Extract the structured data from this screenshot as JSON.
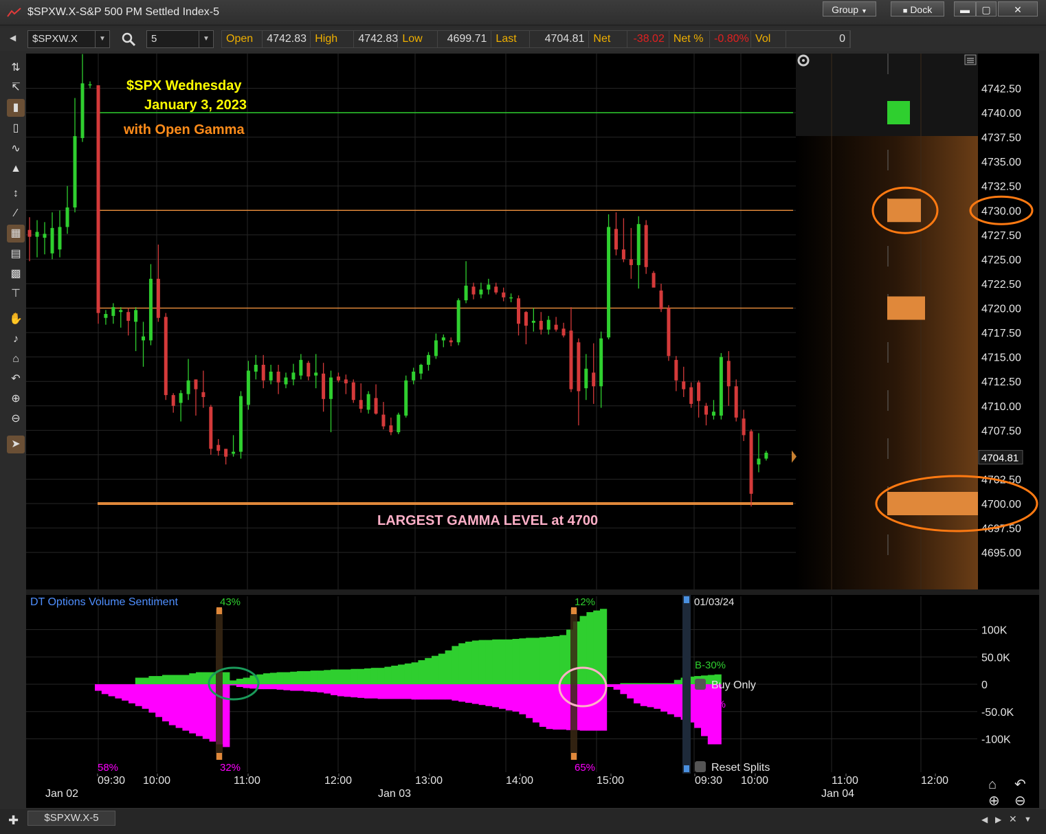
{
  "window": {
    "title": "$SPXW.X-S&P 500 PM Settled Index-5",
    "group_label": "Group",
    "dock_label": "Dock"
  },
  "toolbar": {
    "symbol": "$SPXW.X",
    "interval": "5",
    "quote": [
      {
        "label": "Open",
        "value": "4742.83",
        "style": "normal"
      },
      {
        "label": "High",
        "value": "4742.83",
        "style": "normal"
      },
      {
        "label": "Low",
        "value": "4699.71",
        "style": "normal"
      },
      {
        "label": "Last",
        "value": "4704.81",
        "style": "normal"
      },
      {
        "label": "Net",
        "value": "-38.02",
        "style": "neg"
      },
      {
        "label": "Net %",
        "value": "-0.80%",
        "style": "neg"
      },
      {
        "label": "Vol",
        "value": "0",
        "style": "normal"
      }
    ]
  },
  "annotations": {
    "line1": "$SPX Wednesday",
    "line2": "January  3, 2023",
    "line3": "with Open Gamma",
    "gamma_label": "LARGEST GAMMA LEVEL at 4700"
  },
  "colors": {
    "up": "#2fcf2f",
    "down": "#d43a3a",
    "gamma": "#e0883a",
    "accent_text": "#ffff00",
    "orange_text": "#ff8c1a",
    "pink_text": "#ffb0c8",
    "magenta": "#ff00ff"
  },
  "chart_data": [
    {
      "type": "candlestick",
      "title": "$SPXW.X-S&P 500 PM Settled Index-5",
      "price_axis_ticks": [
        "4742.50",
        "4740.00",
        "4737.50",
        "4735.00",
        "4732.50",
        "4730.00",
        "4727.50",
        "4725.00",
        "4722.50",
        "4720.00",
        "4717.50",
        "4715.00",
        "4712.50",
        "4710.00",
        "4707.50",
        "4705.00",
        "4702.50",
        "4700.00",
        "4697.50",
        "4695.00"
      ],
      "last_price_label": "4704.81",
      "ylim": [
        4693,
        4745
      ],
      "x_tick_labels": [
        "09:30",
        "10:00",
        "11:00",
        "12:00",
        "13:00",
        "14:00",
        "15:00",
        "09:30",
        "10:00",
        "11:00",
        "12:00"
      ],
      "date_labels": [
        "Jan 02",
        "Jan 03",
        "Jan 04"
      ],
      "horizontal_levels": [
        {
          "price": 4740.0,
          "color": "#2fcf2f"
        },
        {
          "price": 4730.0,
          "color": "#e0883a"
        },
        {
          "price": 4720.0,
          "color": "#e0883a"
        },
        {
          "price": 4700.0,
          "color": "#e0883a"
        }
      ],
      "prev_session_candles": [
        {
          "o": 4728.0,
          "h": 4729.3,
          "l": 4724.8,
          "c": 4727.3
        },
        {
          "o": 4727.3,
          "h": 4729.0,
          "l": 4725.2,
          "c": 4727.8
        },
        {
          "o": 4727.2,
          "h": 4728.8,
          "l": 4725.5,
          "c": 4727.6
        },
        {
          "o": 4725.6,
          "h": 4729.8,
          "l": 4725.0,
          "c": 4728.2
        },
        {
          "o": 4726.0,
          "h": 4730.0,
          "l": 4725.2,
          "c": 4728.3
        },
        {
          "o": 4728.3,
          "h": 4732.5,
          "l": 4727.6,
          "c": 4730.3
        },
        {
          "o": 4730.3,
          "h": 4741.5,
          "l": 4729.8,
          "c": 4737.6
        },
        {
          "o": 4737.4,
          "h": 4746.0,
          "l": 4737.0,
          "c": 4743.0
        },
        {
          "o": 4742.8,
          "h": 4743.2,
          "l": 4742.5,
          "c": 4742.9
        }
      ],
      "session_candles": [
        {
          "o": 4742.8,
          "h": 4742.8,
          "l": 4718.4,
          "c": 4719.5
        },
        {
          "o": 4719.0,
          "h": 4719.8,
          "l": 4718.3,
          "c": 4719.4
        },
        {
          "o": 4719.2,
          "h": 4720.5,
          "l": 4718.4,
          "c": 4720.1
        },
        {
          "o": 4719.6,
          "h": 4720.1,
          "l": 4718.0,
          "c": 4719.8
        },
        {
          "o": 4719.6,
          "h": 4720.0,
          "l": 4717.2,
          "c": 4718.7
        },
        {
          "o": 4718.6,
          "h": 4720.1,
          "l": 4715.6,
          "c": 4719.8
        },
        {
          "o": 4716.7,
          "h": 4718.6,
          "l": 4714.0,
          "c": 4717.1
        },
        {
          "o": 4716.7,
          "h": 4724.5,
          "l": 4716.2,
          "c": 4723.0
        },
        {
          "o": 4723.0,
          "h": 4726.5,
          "l": 4718.6,
          "c": 4719.0
        },
        {
          "o": 4719.1,
          "h": 4719.5,
          "l": 4710.6,
          "c": 4711.1
        },
        {
          "o": 4711.1,
          "h": 4711.3,
          "l": 4709.3,
          "c": 4710.0
        },
        {
          "o": 4710.3,
          "h": 4711.6,
          "l": 4708.4,
          "c": 4711.3
        },
        {
          "o": 4711.2,
          "h": 4714.8,
          "l": 4710.6,
          "c": 4712.6
        },
        {
          "o": 4712.7,
          "h": 4712.7,
          "l": 4709.0,
          "c": 4711.7
        },
        {
          "o": 4711.4,
          "h": 4713.6,
          "l": 4709.8,
          "c": 4710.9
        },
        {
          "o": 4709.9,
          "h": 4710.1,
          "l": 4705.0,
          "c": 4705.6
        },
        {
          "o": 4706.0,
          "h": 4706.6,
          "l": 4704.9,
          "c": 4705.4
        },
        {
          "o": 4705.6,
          "h": 4705.6,
          "l": 4704.0,
          "c": 4704.8
        },
        {
          "o": 4705.1,
          "h": 4707.0,
          "l": 4704.8,
          "c": 4705.3
        },
        {
          "o": 4705.3,
          "h": 4711.5,
          "l": 4704.6,
          "c": 4711.0
        },
        {
          "o": 4710.1,
          "h": 4714.6,
          "l": 4709.6,
          "c": 4713.6
        },
        {
          "o": 4713.5,
          "h": 4715.2,
          "l": 4712.7,
          "c": 4714.2
        },
        {
          "o": 4714.2,
          "h": 4715.2,
          "l": 4711.8,
          "c": 4712.6
        },
        {
          "o": 4712.6,
          "h": 4714.2,
          "l": 4712.2,
          "c": 4713.5
        },
        {
          "o": 4713.5,
          "h": 4714.2,
          "l": 4711.2,
          "c": 4712.4
        },
        {
          "o": 4712.2,
          "h": 4713.4,
          "l": 4711.8,
          "c": 4712.9
        },
        {
          "o": 4712.7,
          "h": 4714.3,
          "l": 4712.1,
          "c": 4713.4
        },
        {
          "o": 4713.1,
          "h": 4715.3,
          "l": 4712.7,
          "c": 4714.7
        },
        {
          "o": 4714.4,
          "h": 4714.6,
          "l": 4712.6,
          "c": 4713.0
        },
        {
          "o": 4713.1,
          "h": 4715.3,
          "l": 4711.8,
          "c": 4713.4
        },
        {
          "o": 4713.3,
          "h": 4714.4,
          "l": 4709.4,
          "c": 4710.7
        },
        {
          "o": 4710.7,
          "h": 4713.6,
          "l": 4707.3,
          "c": 4712.9
        },
        {
          "o": 4713.0,
          "h": 4713.4,
          "l": 4712.4,
          "c": 4712.6
        },
        {
          "o": 4712.7,
          "h": 4713.2,
          "l": 4711.2,
          "c": 4712.3
        },
        {
          "o": 4712.4,
          "h": 4712.7,
          "l": 4710.3,
          "c": 4710.6
        },
        {
          "o": 4710.6,
          "h": 4712.3,
          "l": 4709.3,
          "c": 4709.7
        },
        {
          "o": 4709.6,
          "h": 4711.5,
          "l": 4709.2,
          "c": 4711.2
        },
        {
          "o": 4710.8,
          "h": 4712.2,
          "l": 4709.1,
          "c": 4709.2
        },
        {
          "o": 4709.1,
          "h": 4710.4,
          "l": 4707.6,
          "c": 4707.9
        },
        {
          "o": 4708.0,
          "h": 4708.8,
          "l": 4707.0,
          "c": 4707.3
        },
        {
          "o": 4707.3,
          "h": 4709.3,
          "l": 4707.1,
          "c": 4709.1
        },
        {
          "o": 4709.0,
          "h": 4713.1,
          "l": 4708.8,
          "c": 4712.6
        },
        {
          "o": 4712.6,
          "h": 4713.9,
          "l": 4712.2,
          "c": 4713.5
        },
        {
          "o": 4713.3,
          "h": 4714.3,
          "l": 4712.7,
          "c": 4714.2
        },
        {
          "o": 4714.2,
          "h": 4715.5,
          "l": 4713.6,
          "c": 4715.2
        },
        {
          "o": 4715.1,
          "h": 4717.4,
          "l": 4714.8,
          "c": 4716.7
        },
        {
          "o": 4716.7,
          "h": 4717.3,
          "l": 4716.0,
          "c": 4717.0
        },
        {
          "o": 4716.7,
          "h": 4717.0,
          "l": 4716.1,
          "c": 4716.5
        },
        {
          "o": 4716.5,
          "h": 4721.0,
          "l": 4716.2,
          "c": 4720.8
        },
        {
          "o": 4720.8,
          "h": 4724.8,
          "l": 4720.5,
          "c": 4722.3
        },
        {
          "o": 4722.2,
          "h": 4722.6,
          "l": 4720.9,
          "c": 4721.4
        },
        {
          "o": 4721.4,
          "h": 4722.6,
          "l": 4721.0,
          "c": 4721.9
        },
        {
          "o": 4721.9,
          "h": 4723.0,
          "l": 4721.4,
          "c": 4722.4
        },
        {
          "o": 4722.2,
          "h": 4722.6,
          "l": 4721.4,
          "c": 4721.6
        },
        {
          "o": 4721.6,
          "h": 4722.1,
          "l": 4720.7,
          "c": 4721.1
        },
        {
          "o": 4721.0,
          "h": 4721.5,
          "l": 4720.6,
          "c": 4721.1
        },
        {
          "o": 4721.0,
          "h": 4721.3,
          "l": 4717.2,
          "c": 4718.4
        },
        {
          "o": 4719.6,
          "h": 4719.7,
          "l": 4716.3,
          "c": 4718.2
        },
        {
          "o": 4718.5,
          "h": 4720.0,
          "l": 4717.6,
          "c": 4718.7
        },
        {
          "o": 4718.7,
          "h": 4719.6,
          "l": 4717.3,
          "c": 4717.8
        },
        {
          "o": 4717.8,
          "h": 4719.2,
          "l": 4717.3,
          "c": 4718.8
        },
        {
          "o": 4718.3,
          "h": 4719.1,
          "l": 4717.6,
          "c": 4717.8
        },
        {
          "o": 4717.9,
          "h": 4718.5,
          "l": 4717.0,
          "c": 4717.2
        },
        {
          "o": 4717.7,
          "h": 4720.1,
          "l": 4711.4,
          "c": 4711.7
        },
        {
          "o": 4716.5,
          "h": 4716.9,
          "l": 4708.0,
          "c": 4711.5
        },
        {
          "o": 4711.8,
          "h": 4715.3,
          "l": 4710.6,
          "c": 4713.8
        },
        {
          "o": 4713.4,
          "h": 4716.4,
          "l": 4710.2,
          "c": 4712.0
        },
        {
          "o": 4712.0,
          "h": 4717.6,
          "l": 4709.8,
          "c": 4716.9
        },
        {
          "o": 4717.0,
          "h": 4729.6,
          "l": 4716.8,
          "c": 4728.3
        },
        {
          "o": 4728.1,
          "h": 4729.8,
          "l": 4725.4,
          "c": 4726.0
        },
        {
          "o": 4726.0,
          "h": 4729.2,
          "l": 4724.7,
          "c": 4725.0
        },
        {
          "o": 4725.0,
          "h": 4728.2,
          "l": 4723.0,
          "c": 4724.4
        },
        {
          "o": 4724.4,
          "h": 4729.4,
          "l": 4722.0,
          "c": 4728.6
        },
        {
          "o": 4728.5,
          "h": 4729.0,
          "l": 4723.5,
          "c": 4724.2
        },
        {
          "o": 4723.6,
          "h": 4723.8,
          "l": 4722.2,
          "c": 4722.1
        },
        {
          "o": 4721.8,
          "h": 4722.5,
          "l": 4719.6,
          "c": 4719.9
        },
        {
          "o": 4720.0,
          "h": 4720.3,
          "l": 4714.6,
          "c": 4715.1
        },
        {
          "o": 4714.7,
          "h": 4715.1,
          "l": 4711.5,
          "c": 4712.6
        },
        {
          "o": 4712.5,
          "h": 4714.0,
          "l": 4710.9,
          "c": 4711.7
        },
        {
          "o": 4711.9,
          "h": 4712.4,
          "l": 4709.8,
          "c": 4710.2
        },
        {
          "o": 4712.4,
          "h": 4712.6,
          "l": 4708.8,
          "c": 4710.5
        },
        {
          "o": 4710.0,
          "h": 4710.3,
          "l": 4708.0,
          "c": 4709.1
        },
        {
          "o": 4709.0,
          "h": 4710.6,
          "l": 4708.6,
          "c": 4709.4
        },
        {
          "o": 4709.0,
          "h": 4715.4,
          "l": 4708.6,
          "c": 4715.0
        },
        {
          "o": 4714.6,
          "h": 4715.6,
          "l": 4710.0,
          "c": 4712.0
        },
        {
          "o": 4712.0,
          "h": 4712.7,
          "l": 4708.4,
          "c": 4708.8
        },
        {
          "o": 4708.7,
          "h": 4709.6,
          "l": 4706.4,
          "c": 4707.0
        },
        {
          "o": 4707.4,
          "h": 4707.6,
          "l": 4699.7,
          "c": 4701.0
        },
        {
          "o": 4704.0,
          "h": 4707.2,
          "l": 4703.2,
          "c": 4704.6
        },
        {
          "o": 4704.6,
          "h": 4705.4,
          "l": 4704.4,
          "c": 4705.2
        }
      ],
      "gamma_profile": [
        {
          "price": 4740.0,
          "magnitude": 0.25,
          "color": "#2fcf2f"
        },
        {
          "price": 4730.0,
          "magnitude": 0.37,
          "color": "#e0883a"
        },
        {
          "price": 4720.0,
          "magnitude": 0.42,
          "color": "#e0883a"
        },
        {
          "price": 4700.0,
          "magnitude": 1.0,
          "color": "#e0883a"
        }
      ],
      "circled_levels": [
        "4730.00",
        "4700.00"
      ]
    },
    {
      "type": "area",
      "title": "DT Options Volume Sentiment",
      "y_axis_ticks": [
        "100K",
        "50.0K",
        "0",
        "-50.0K",
        "-100K"
      ],
      "ylim": [
        -150000,
        130000
      ],
      "legend": {
        "buy": "B-30%",
        "sell": "B-47%",
        "mode": "Buy Only"
      },
      "reset_label": "Reset Splits",
      "date_label": "01/03/24",
      "split_markers": [
        {
          "top": "43%",
          "bottom": "32%"
        },
        {
          "top": "12%",
          "bottom": "65%"
        }
      ],
      "start_pct": "58%",
      "series": [
        {
          "name": "B-30%",
          "color": "#2fcf2f",
          "values": [
            0,
            0,
            0,
            0,
            0,
            0,
            12000,
            12000,
            15000,
            15000,
            17000,
            17000,
            17000,
            17000,
            20000,
            22000,
            22000,
            22000,
            22000,
            22000,
            7000,
            10000,
            12000,
            16000,
            18000,
            20000,
            21000,
            22000,
            22000,
            23000,
            24000,
            24000,
            25000,
            25000,
            26000,
            27000,
            27000,
            27000,
            28000,
            28000,
            29000,
            30000,
            30000,
            32000,
            34000,
            36000,
            38000,
            40000,
            44000,
            48000,
            52000,
            56000,
            62000,
            70000,
            75000,
            78000,
            80000,
            81000,
            81000,
            82000,
            82000,
            82000,
            83000,
            84000,
            85000,
            85000,
            86000,
            87000,
            88000,
            90000,
            100000,
            115000,
            125000,
            132000,
            135000,
            138000,
            0,
            0,
            2000,
            2000,
            2000,
            2000,
            2000,
            2000,
            2000,
            2000,
            8000,
            12000,
            14000,
            15000,
            16000,
            17000,
            18000
          ]
        },
        {
          "name": "B-47%",
          "color": "#ff00ff",
          "values": [
            -12000,
            -18000,
            -22000,
            -26000,
            -30000,
            -35000,
            -40000,
            -45000,
            -52000,
            -60000,
            -68000,
            -75000,
            -80000,
            -85000,
            -90000,
            -95000,
            -100000,
            -105000,
            -110000,
            -115000,
            -2000,
            -5000,
            -7000,
            -8000,
            -9000,
            -9000,
            -9000,
            -10000,
            -11000,
            -12000,
            -12000,
            -13000,
            -14000,
            -15000,
            -17000,
            -20000,
            -22000,
            -23000,
            -24000,
            -25000,
            -26000,
            -26000,
            -27000,
            -27000,
            -27000,
            -27000,
            -27000,
            -28000,
            -28000,
            -28000,
            -28000,
            -28000,
            -28000,
            -30000,
            -32000,
            -34000,
            -36000,
            -38000,
            -40000,
            -42000,
            -45000,
            -48000,
            -50000,
            -55000,
            -62000,
            -70000,
            -78000,
            -82000,
            -83000,
            -83000,
            -84000,
            -84000,
            -85000,
            -85000,
            -85000,
            -85000,
            -5000,
            -10000,
            -18000,
            -26000,
            -35000,
            -40000,
            -42000,
            -45000,
            -50000,
            -55000,
            -60000,
            -65000,
            -70000,
            -80000,
            -95000,
            -110000,
            -110000
          ]
        }
      ]
    }
  ],
  "bottom": {
    "tab_label": "$SPXW.X-5"
  }
}
